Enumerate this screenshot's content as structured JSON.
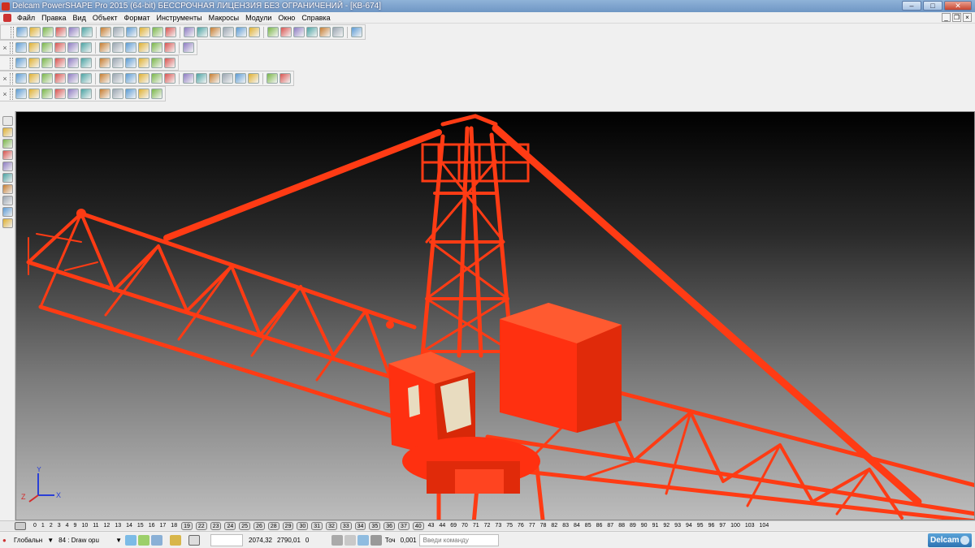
{
  "window": {
    "title": "Delcam PowerSHAPE Pro 2015 (64-bit) БЕССРОЧНАЯ ЛИЦЕНЗИЯ БЕЗ ОГРАНИЧЕНИЙ - [КВ-674]",
    "controls": [
      "minimize-icon",
      "maximize-icon",
      "close-icon"
    ]
  },
  "menu": {
    "items": [
      "Файл",
      "Правка",
      "Вид",
      "Объект",
      "Формат",
      "Инструменты",
      "Макросы",
      "Модули",
      "Окно",
      "Справка"
    ],
    "mdi_controls": [
      "minimize-icon",
      "restore-icon",
      "close-icon"
    ]
  },
  "toolbars": {
    "row1_icons": [
      "new-file-icon",
      "open-file-icon",
      "save-icon",
      "save-as-icon",
      "print-icon",
      "import-icon",
      "cut-icon",
      "copy-icon",
      "paste-icon",
      "delete-icon",
      "erase-icon",
      "undo-icon",
      "redo-icon",
      "text-icon",
      "select-icon",
      "dimension-icon",
      "line-icon",
      "arc-icon",
      "circle-icon",
      "curve-icon",
      "surface-icon",
      "solid-icon",
      "shaded-icon",
      "toolpath-icon",
      "wizard-icon"
    ],
    "row2_icons": [
      "view-top-icon",
      "view-front-icon",
      "view-side-icon",
      "view-iso-icon",
      "view-iso2-icon",
      "zoom-in-icon",
      "zoom-out-icon",
      "zoom-all-icon",
      "zoom-window-icon",
      "shading-icon",
      "wireframe-icon",
      "lamp-icon",
      "hand-icon"
    ],
    "row3_icons": [
      "solid-block-icon",
      "solid-cylinder-icon",
      "solid-cone-icon",
      "solid-sphere-icon",
      "solid-torus-icon",
      "solid-extrude-icon",
      "solid-revolve-icon",
      "solid-sweep-icon",
      "solid-drive-icon",
      "solid-boolean-icon",
      "solid-feature-icon",
      "solid-cut-icon"
    ],
    "row4_icons": [
      "feature-icon",
      "feature-hole-icon",
      "feature-boss-icon",
      "feature-pocket-icon",
      "feature-fillet-icon",
      "feature-chamfer-icon",
      "feature-shell-icon",
      "feature-draft-icon",
      "feature-split-icon",
      "feature-cut-icon",
      "feature-pattern-icon",
      "feature-mirror-icon",
      "feature-offset-icon",
      "feature-thicken-icon",
      "feature-replace-icon",
      "feature-move-icon",
      "feature-scale-icon",
      "feature-remove-icon",
      "feature-suppress-icon",
      "feature-unsuppress-icon"
    ],
    "row5_icons": [
      "edit-icon",
      "rename-icon",
      "surface-patch-icon",
      "surface-blend-icon",
      "surface-fill-icon",
      "surface-trim-icon",
      "surface-offset-icon",
      "surface-extend-icon",
      "surface-join-icon",
      "surface-fillet-icon",
      "surface-project-icon"
    ]
  },
  "left_toolbar_icons": [
    "pointer-icon",
    "select-all-icon",
    "point-icon",
    "line-tool-icon",
    "arc-tool-icon",
    "curve-tool-icon",
    "surface-tool-icon",
    "solid-tool-icon",
    "text-tool-icon",
    "dim-tool-icon"
  ],
  "viewport": {
    "background_top": "#000000",
    "background_bottom": "#bdbdbd",
    "model_color": "#ff3b14",
    "axis_labels": {
      "y": "Y",
      "z": "Z",
      "x": "X"
    }
  },
  "levels": {
    "plain": [
      "0",
      "1",
      "2",
      "3",
      "4",
      "9",
      "10",
      "11",
      "12",
      "13",
      "14",
      "15",
      "16",
      "17",
      "18"
    ],
    "on": [
      "19",
      "22",
      "23",
      "24",
      "25",
      "26",
      "28",
      "29",
      "30",
      "31",
      "32",
      "33",
      "34",
      "35",
      "36",
      "37",
      "40"
    ],
    "rest": [
      "43",
      "44",
      "69",
      "70",
      "71",
      "72",
      "73",
      "75",
      "76",
      "77",
      "78",
      "82",
      "83",
      "84",
      "85",
      "86",
      "87",
      "88",
      "89",
      "90",
      "91",
      "92",
      "93",
      "94",
      "95",
      "96",
      "97",
      "100",
      "103",
      "104"
    ]
  },
  "status": {
    "workplane_label": "Глобальн",
    "workplane_dropdown": "chevron-down-icon",
    "level_label": "84 : Draw opu",
    "x_coord": "2074,32",
    "y_coord": "2790,01",
    "z_coord": "0",
    "tolerance_label": "Точ",
    "tolerance_value": "0,001",
    "command_placeholder": "Введи команду",
    "brand": "Delcam"
  }
}
